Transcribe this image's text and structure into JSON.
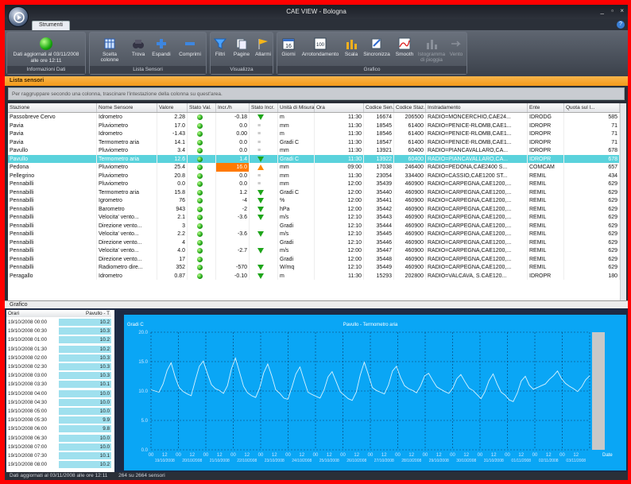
{
  "window": {
    "title": "CAE VIEW - Bologna",
    "controls": [
      "_",
      "▫",
      "×"
    ]
  },
  "tabs": [
    {
      "label": "Strumenti"
    }
  ],
  "ribbon": {
    "informazioni": {
      "label": "Informazioni Dati",
      "status_text": "Dati aggiornati al 03/11/2008 alle ore 12:11"
    },
    "lista_sensori": {
      "label": "Lista Sensori",
      "buttons": [
        "Scelta colonne",
        "Trova",
        "Espandi",
        "Comprimi"
      ]
    },
    "visualizza": {
      "label": "Visualizza",
      "buttons": [
        "Filtri",
        "Pagine",
        "Allarmi"
      ]
    },
    "grafico": {
      "label": "Grafico",
      "buttons": [
        "Giorni",
        "Arrotondamento",
        "Scala",
        "Sincronizza",
        "Smooth",
        "Istogramma di pioggia",
        "Vento"
      ]
    }
  },
  "sensors_panel": {
    "title": "Lista sensori",
    "group_hint": "Per raggruppare secondo una colonna, trascinare l'intestazione della colonna su quest'area.",
    "columns": [
      "Stazione",
      "Nome Sensore",
      "Valore",
      "Stato Val.",
      "Incr./h",
      "Stato Incr.",
      "Unità di Misura",
      "Ora",
      "Codice Sen...",
      "Codice Staz...",
      "Instradamento",
      "Ente",
      "Quota sul l..."
    ],
    "rows": [
      {
        "stazione": "Passobreve Cervo",
        "sensore": "Idrometro",
        "valore": "2.28",
        "incr": "-0.18",
        "incr_state": "down",
        "unita": "m",
        "ora": "11:30",
        "cod_sen": "16674",
        "cod_staz": "206500",
        "instr": "RADIO=MONCERCHIO,CAE24...",
        "ente": "IDRODG",
        "quota": "585"
      },
      {
        "stazione": "Pavia",
        "sensore": "Pluviometro",
        "valore": "17.0",
        "incr": "0.0",
        "incr_state": "eq",
        "unita": "mm",
        "ora": "11:30",
        "cod_sen": "18545",
        "cod_staz": "61400",
        "instr": "RADIO=PENICE-RLOMB,CAE1...",
        "ente": "IDROPR",
        "quota": "71"
      },
      {
        "stazione": "Pavia",
        "sensore": "Idrometro",
        "valore": "-1.43",
        "incr": "0.00",
        "incr_state": "eq",
        "unita": "m",
        "ora": "11:30",
        "cod_sen": "18546",
        "cod_staz": "61400",
        "instr": "RADIO=PENICE-RLOMB,CAE1...",
        "ente": "IDROPR",
        "quota": "71"
      },
      {
        "stazione": "Pavia",
        "sensore": "Termometro aria",
        "valore": "14.1",
        "incr": "0.0",
        "incr_state": "eq",
        "unita": "Gradi C",
        "ora": "11:30",
        "cod_sen": "18547",
        "cod_staz": "61400",
        "instr": "RADIO=PENICE-RLOMB,CAE1...",
        "ente": "IDROPR",
        "quota": "71"
      },
      {
        "stazione": "Pavullo",
        "sensore": "Pluviometro",
        "valore": "3.4",
        "incr": "0.0",
        "incr_state": "eq",
        "unita": "mm",
        "ora": "11:30",
        "cod_sen": "13921",
        "cod_staz": "60400",
        "instr": "RADIO=PIANCAVALLARO,CA...",
        "ente": "IDROPR",
        "quota": "678"
      },
      {
        "stazione": "Pavullo",
        "sensore": "Termometro aria",
        "valore": "12.6",
        "incr": "1.4",
        "incr_state": "down",
        "unita": "Gradi C",
        "ora": "11:30",
        "cod_sen": "13922",
        "cod_staz": "60400",
        "instr": "RADIO=PIANCAVALLARO,CA...",
        "ente": "IDROPR",
        "quota": "678",
        "selected": true
      },
      {
        "stazione": "Pedona",
        "sensore": "Pluviometro",
        "valore": "25.4",
        "incr": "16.0",
        "incr_state": "up",
        "unita": "mm",
        "ora": "09:00",
        "cod_sen": "17038",
        "cod_staz": "246400",
        "instr": "RADIO=PEDONA,CAE2400 S...",
        "ente": "COMCAM",
        "quota": "657",
        "alert": true
      },
      {
        "stazione": "Pellegrino",
        "sensore": "Pluviometro",
        "valore": "20.8",
        "incr": "0.0",
        "incr_state": "eq",
        "unita": "mm",
        "ora": "11:30",
        "cod_sen": "23054",
        "cod_staz": "334400",
        "instr": "RADIO=CASSIO,CAE1200 ST...",
        "ente": "REMIL",
        "quota": "434"
      },
      {
        "stazione": "Pennabilli",
        "sensore": "Pluviometro",
        "valore": "0.0",
        "incr": "0.0",
        "incr_state": "eq",
        "unita": "mm",
        "ora": "12:00",
        "cod_sen": "35439",
        "cod_staz": "460900",
        "instr": "RADIO=CARPEGNA,CAE1200,...",
        "ente": "REMIL",
        "quota": "629"
      },
      {
        "stazione": "Pennabilli",
        "sensore": "Termometro aria",
        "valore": "15.8",
        "incr": "1.2",
        "incr_state": "down",
        "unita": "Gradi C",
        "ora": "12:00",
        "cod_sen": "35440",
        "cod_staz": "460900",
        "instr": "RADIO=CARPEGNA,CAE1200,...",
        "ente": "REMIL",
        "quota": "629"
      },
      {
        "stazione": "Pennabilli",
        "sensore": "Igrometro",
        "valore": "76",
        "incr": "-4",
        "incr_state": "down",
        "unita": "%",
        "ora": "12:00",
        "cod_sen": "35441",
        "cod_staz": "460900",
        "instr": "RADIO=CARPEGNA,CAE1200,...",
        "ente": "REMIL",
        "quota": "629"
      },
      {
        "stazione": "Pennabilli",
        "sensore": "Barometro",
        "valore": "943",
        "incr": "-2",
        "incr_state": "down",
        "unita": "hPa",
        "ora": "12:00",
        "cod_sen": "35442",
        "cod_staz": "460900",
        "instr": "RADIO=CARPEGNA,CAE1200,...",
        "ente": "REMIL",
        "quota": "629"
      },
      {
        "stazione": "Pennabilli",
        "sensore": "Velocita' vento...",
        "valore": "2.1",
        "incr": "-3.6",
        "incr_state": "down",
        "unita": "m/s",
        "ora": "12:10",
        "cod_sen": "35443",
        "cod_staz": "460900",
        "instr": "RADIO=CARPEGNA,CAE1200,...",
        "ente": "REMIL",
        "quota": "629"
      },
      {
        "stazione": "Pennabilli",
        "sensore": "Direzione vento...",
        "valore": "3",
        "incr": "",
        "incr_state": "none",
        "unita": "Gradi",
        "ora": "12:10",
        "cod_sen": "35444",
        "cod_staz": "460900",
        "instr": "RADIO=CARPEGNA,CAE1200,...",
        "ente": "REMIL",
        "quota": "629"
      },
      {
        "stazione": "Pennabilli",
        "sensore": "Velocita' vento...",
        "valore": "2.2",
        "incr": "-3.6",
        "incr_state": "down",
        "unita": "m/s",
        "ora": "12:10",
        "cod_sen": "35445",
        "cod_staz": "460900",
        "instr": "RADIO=CARPEGNA,CAE1200,...",
        "ente": "REMIL",
        "quota": "629"
      },
      {
        "stazione": "Pennabilli",
        "sensore": "Direzione vento...",
        "valore": "4",
        "incr": "",
        "incr_state": "none",
        "unita": "Gradi",
        "ora": "12:10",
        "cod_sen": "35446",
        "cod_staz": "460900",
        "instr": "RADIO=CARPEGNA,CAE1200,...",
        "ente": "REMIL",
        "quota": "629"
      },
      {
        "stazione": "Pennabilli",
        "sensore": "Velocita' vento...",
        "valore": "4.0",
        "incr": "-2.7",
        "incr_state": "down",
        "unita": "m/s",
        "ora": "12:00",
        "cod_sen": "35447",
        "cod_staz": "460900",
        "instr": "RADIO=CARPEGNA,CAE1200,...",
        "ente": "REMIL",
        "quota": "629"
      },
      {
        "stazione": "Pennabilli",
        "sensore": "Direzione vento...",
        "valore": "17",
        "incr": "",
        "incr_state": "none",
        "unita": "Gradi",
        "ora": "12:00",
        "cod_sen": "35448",
        "cod_staz": "460900",
        "instr": "RADIO=CARPEGNA,CAE1200,...",
        "ente": "REMIL",
        "quota": "629"
      },
      {
        "stazione": "Pennabilli",
        "sensore": "Radiometro dire...",
        "valore": "352",
        "incr": "-570",
        "incr_state": "down",
        "unita": "W/mq",
        "ora": "12:10",
        "cod_sen": "35449",
        "cod_staz": "460900",
        "instr": "RADIO=CARPEGNA,CAE1200,...",
        "ente": "REMIL",
        "quota": "629"
      },
      {
        "stazione": "Peragallo",
        "sensore": "Idrometro",
        "valore": "0.87",
        "incr": "-0.10",
        "incr_state": "down",
        "unita": "m",
        "ora": "11:30",
        "cod_sen": "15293",
        "cod_staz": "202800",
        "instr": "RADIO=VALCAVA, S.CAE120...",
        "ente": "IDROPR",
        "quota": "180"
      }
    ]
  },
  "chart_panel": {
    "title": "Grafico",
    "table_headers": [
      "Orari",
      "Pavullo - T"
    ],
    "table_rows": [
      [
        "19/10/2008 00:00",
        "10.2"
      ],
      [
        "19/10/2008 00:30",
        "10.3"
      ],
      [
        "19/10/2008 01:00",
        "10.2"
      ],
      [
        "19/10/2008 01:30",
        "10.2"
      ],
      [
        "19/10/2008 02:00",
        "10.3"
      ],
      [
        "19/10/2008 02:30",
        "10.3"
      ],
      [
        "19/10/2008 03:00",
        "10.3"
      ],
      [
        "19/10/2008 03:30",
        "10.1"
      ],
      [
        "19/10/2008 04:00",
        "10.0"
      ],
      [
        "19/10/2008 04:30",
        "10.0"
      ],
      [
        "19/10/2008 05:00",
        "10.0"
      ],
      [
        "19/10/2008 05:30",
        "9.9"
      ],
      [
        "19/10/2008 06:00",
        "9.8"
      ],
      [
        "19/10/2008 06:30",
        "10.0"
      ],
      [
        "19/10/2008 07:00",
        "10.0"
      ],
      [
        "19/10/2008 07:30",
        "10.1"
      ],
      [
        "19/10/2008 08:00",
        "10.2"
      ]
    ]
  },
  "chart_data": {
    "type": "line",
    "title": "Pavullo - Termometro aria",
    "ylabel": "Gradi C",
    "xlabel": "Date",
    "ylim": [
      0,
      20
    ],
    "grid": true,
    "day_labels": [
      "19/10/2008",
      "20/10/2008",
      "21/10/2008",
      "22/10/2008",
      "23/10/2008",
      "24/10/2008",
      "25/10/2008",
      "26/10/2008",
      "27/10/2008",
      "28/10/2008",
      "29/10/2008",
      "30/10/2008",
      "31/10/2008",
      "01/11/2008",
      "02/11/2008",
      "03/11/2008"
    ],
    "series": [
      {
        "name": "Pavullo - T",
        "values": [
          10.2,
          10.0,
          9.8,
          11.2,
          13.5,
          14.8,
          12.4,
          10.6,
          9.9,
          9.5,
          9.2,
          11.8,
          14.2,
          15.1,
          13.0,
          11.1,
          10.4,
          10.1,
          9.6,
          10.9,
          13.8,
          15.6,
          13.2,
          10.8,
          9.7,
          9.2,
          8.9,
          10.5,
          13.1,
          14.6,
          12.6,
          10.2,
          9.6,
          8.8,
          8.6,
          10.6,
          12.9,
          14.1,
          11.9,
          9.8,
          9.4,
          9.1,
          8.8,
          10.2,
          12.4,
          13.3,
          11.6,
          9.9,
          9.3,
          8.7,
          8.4,
          9.8,
          12.7,
          14.9,
          12.8,
          10.6,
          10.1,
          9.8,
          9.5,
          11.0,
          13.4,
          14.2,
          12.3,
          10.9,
          10.4,
          10.1,
          9.7,
          10.9,
          12.6,
          13.0,
          11.8,
          10.7,
          10.3,
          9.9,
          9.6,
          10.5,
          12.1,
          12.8,
          11.6,
          10.5,
          10.1,
          9.4,
          8.7,
          9.9,
          11.8,
          12.9,
          11.2,
          9.8,
          9.3,
          8.5,
          8.2,
          9.6,
          11.7,
          12.5,
          11.0,
          10.3,
          10.6,
          10.9,
          11.2,
          12.0,
          12.6,
          13.4,
          12.1,
          11.3,
          10.8,
          10.4,
          9.9,
          10.7,
          11.9,
          12.6
        ]
      }
    ]
  },
  "statusbar": {
    "left": "Dati aggiornati al 03/11/2008 alle ore 12:11",
    "right": "264 su 2664 sensori"
  }
}
